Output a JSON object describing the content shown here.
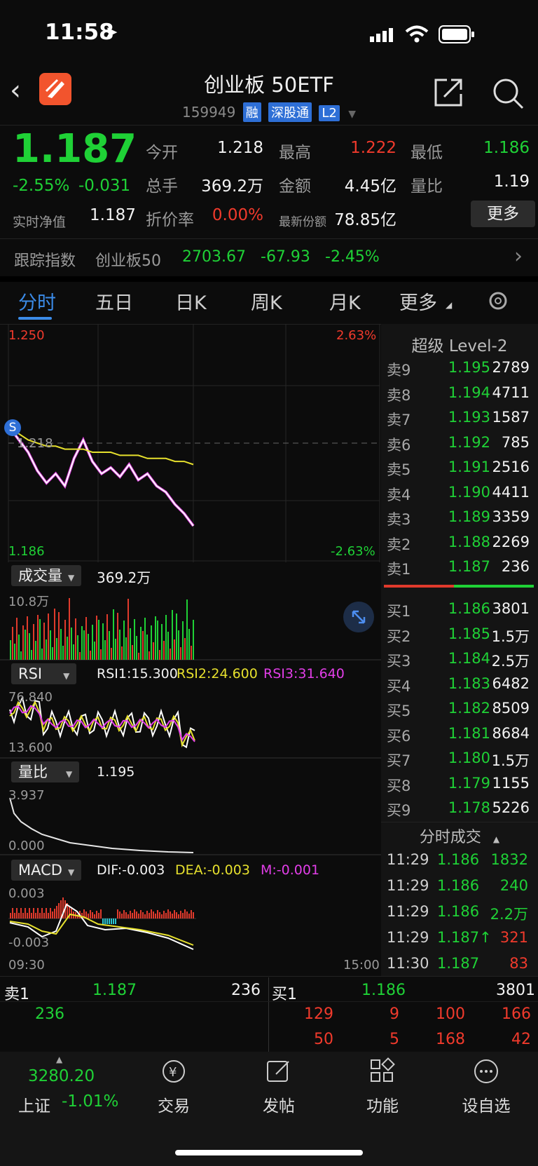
{
  "status": {
    "time": "11:58"
  },
  "nav": {
    "title": "创业板 50ETF",
    "code": "159949",
    "tags": [
      "融",
      "深股通",
      "L2"
    ]
  },
  "quote": {
    "price": "1.187",
    "chg_pct": "-2.55%",
    "chg": "-0.031",
    "nav_label": "实时净值",
    "nav": "1.187",
    "open_label": "今开",
    "open": "1.218",
    "high_label": "最高",
    "high": "1.222",
    "low_label": "最低",
    "low": "1.186",
    "vol_label": "总手",
    "vol": "369.2万",
    "amt_label": "金额",
    "amt": "4.45亿",
    "ratio_label": "量比",
    "ratio": "1.19",
    "disc_label": "折价率",
    "disc": "0.00%",
    "shares_label": "最新份额",
    "shares": "78.85亿",
    "more": "更多"
  },
  "index": {
    "label": "跟踪指数",
    "name": "创业板50",
    "value": "2703.67",
    "chg": "-67.93",
    "pct": "-2.45%"
  },
  "tabs": [
    "分时",
    "五日",
    "日K",
    "周K",
    "月K",
    "更多"
  ],
  "chart_labels": {
    "ytop": "1.250",
    "ybot": "1.186",
    "ref": "1.218",
    "pct_top": "2.63%",
    "pct_bot": "-2.63%",
    "vol_btn": "成交量",
    "vol_val": "369.2万",
    "vol_max": "10.8万",
    "rsi_btn": "RSI",
    "rsi1": "RSI1:15.300",
    "rsi2": "RSI2:24.600",
    "rsi3": "RSI3:31.640",
    "rsi_top": "76.840",
    "rsi_bot": "13.600",
    "lb_btn": "量比",
    "lb_val": "1.195",
    "lb_top": "3.937",
    "lb_bot": "0.000",
    "macd_btn": "MACD",
    "dif": "DIF:-0.003",
    "dea": "DEA:-0.003",
    "m": "M:-0.001",
    "macd_top": "0.003",
    "macd_bot": "-0.003",
    "t_start": "09:30",
    "t_end": "15:00",
    "marker": "S"
  },
  "chart_data": {
    "type": "line",
    "x_range": [
      "09:30",
      "15:00"
    ],
    "ylim": [
      1.186,
      1.25
    ],
    "series": [
      {
        "values": [
          1.218,
          1.214,
          1.21,
          1.204,
          1.2,
          1.203,
          1.199,
          1.208,
          1.214,
          1.207,
          1.203,
          1.205,
          1.202,
          1.206,
          1.201,
          1.203,
          1.199,
          1.197,
          1.193,
          1.19,
          1.186
        ]
      },
      {
        "values": [
          1.218,
          1.216,
          1.214,
          1.213,
          1.212,
          1.212,
          1.211,
          1.211,
          1.211,
          1.21,
          1.21,
          1.21,
          1.209,
          1.209,
          1.209,
          1.208,
          1.208,
          1.208,
          1.207,
          1.207,
          1.206
        ]
      }
    ]
  },
  "level2": {
    "title": "超级 Level-2",
    "asks": [
      {
        "l": "卖9",
        "p": "1.195",
        "v": "2789"
      },
      {
        "l": "卖8",
        "p": "1.194",
        "v": "4711"
      },
      {
        "l": "卖7",
        "p": "1.193",
        "v": "1587"
      },
      {
        "l": "卖6",
        "p": "1.192",
        "v": "785"
      },
      {
        "l": "卖5",
        "p": "1.191",
        "v": "2516"
      },
      {
        "l": "卖4",
        "p": "1.190",
        "v": "4411"
      },
      {
        "l": "卖3",
        "p": "1.189",
        "v": "3359"
      },
      {
        "l": "卖2",
        "p": "1.188",
        "v": "2269"
      },
      {
        "l": "卖1",
        "p": "1.187",
        "v": "236"
      }
    ],
    "bids": [
      {
        "l": "买1",
        "p": "1.186",
        "v": "3801"
      },
      {
        "l": "买2",
        "p": "1.185",
        "v": "1.5万"
      },
      {
        "l": "买3",
        "p": "1.184",
        "v": "2.5万"
      },
      {
        "l": "买4",
        "p": "1.183",
        "v": "6482"
      },
      {
        "l": "买5",
        "p": "1.182",
        "v": "8509"
      },
      {
        "l": "买6",
        "p": "1.181",
        "v": "8684"
      },
      {
        "l": "买7",
        "p": "1.180",
        "v": "1.5万"
      },
      {
        "l": "买8",
        "p": "1.179",
        "v": "1155"
      },
      {
        "l": "买9",
        "p": "1.178",
        "v": "5226"
      }
    ],
    "trades_title": "分时成交",
    "trades": [
      {
        "t": "11:29",
        "p": "1.186",
        "v": "1832",
        "pc": "green",
        "vc": "green"
      },
      {
        "t": "11:29",
        "p": "1.186",
        "v": "240",
        "pc": "green",
        "vc": "green"
      },
      {
        "t": "11:29",
        "p": "1.186",
        "v": "2.2万",
        "pc": "green",
        "vc": "green"
      },
      {
        "t": "11:29",
        "p": "1.187↑",
        "v": "321",
        "pc": "green",
        "vc": "red"
      },
      {
        "t": "11:30",
        "p": "1.187",
        "v": "83",
        "pc": "green",
        "vc": "red"
      }
    ]
  },
  "queue": {
    "sell_label": "卖1",
    "sell_price": "1.187",
    "sell_vol": "236",
    "sell_items": [
      "236"
    ],
    "buy_label": "买1",
    "buy_price": "1.186",
    "buy_vol": "3801",
    "buy_items": [
      "129",
      "9",
      "100",
      "166",
      "50",
      "5",
      "168",
      "42"
    ]
  },
  "bottom": {
    "index_value": "3280.20",
    "index_name": "上证",
    "index_pct": "-1.01%",
    "items": [
      "交易",
      "发帖",
      "功能",
      "设自选"
    ]
  }
}
